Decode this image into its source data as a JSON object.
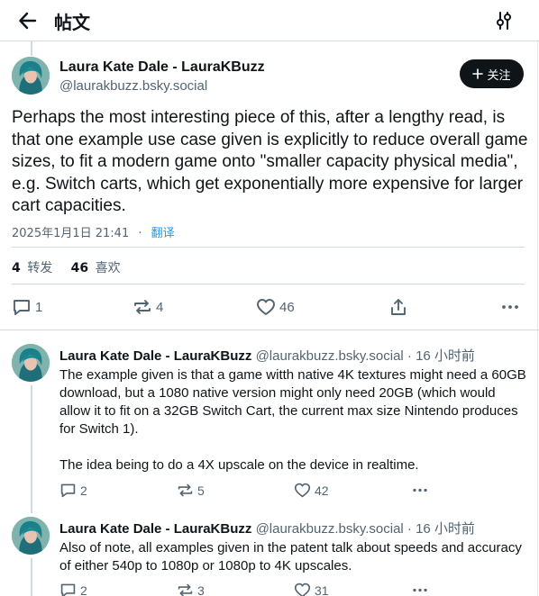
{
  "header": {
    "title": "帖文"
  },
  "post": {
    "author_name": "Laura Kate Dale - LauraKBuzz",
    "author_handle": "@laurakbuzz.bsky.social",
    "follow_label": "关注",
    "text": "Perhaps the most interesting piece of this, after a lengthy read, is that one example use case given is explicitly to reduce overall game sizes, to fit a modern game onto \"smaller capacity physical media\", e.g. Switch carts, which get exponentially more expensive for larger cart capacities.",
    "timestamp": "2025年1月1日 21:41",
    "separator": "·",
    "translate_label": "翻译",
    "reposts_count": "4",
    "reposts_label": "转发",
    "likes_count": "46",
    "likes_label": "喜欢",
    "actions": {
      "replies": "1",
      "reposts": "4",
      "likes": "46"
    }
  },
  "replies": [
    {
      "author_name": "Laura Kate Dale - LauraKBuzz",
      "author_handle": "@laurakbuzz.bsky.social",
      "time": "· 16 小时前",
      "paragraphs": [
        "The example given is that a game witth native 4K textures might need a 60GB download, but a 1080 native version might only need 20GB (which would allow it to fit on a 32GB Switch Cart, the current max size Nintendo produces for Switch 1).",
        "The idea being to do a 4X upscale on the device in realtime."
      ],
      "actions": {
        "replies": "2",
        "reposts": "5",
        "likes": "42"
      }
    },
    {
      "author_name": "Laura Kate Dale - LauraKBuzz",
      "author_handle": "@laurakbuzz.bsky.social",
      "time": "· 16 小时前",
      "paragraphs": [
        "Also of note, all examples given in the patent talk about speeds and accuracy of either 540p to 1080p or 1080p to 4K upscales."
      ],
      "actions": {
        "replies": "2",
        "reposts": "3",
        "likes": "31"
      }
    }
  ],
  "colors": {
    "accent": "#1d9bf0",
    "text": "#0f1419",
    "muted": "#536471",
    "border": "#cfd9de"
  },
  "icons": [
    "back-arrow-icon",
    "filter-icon",
    "plus-icon",
    "reply-icon",
    "repost-icon",
    "like-icon",
    "share-icon",
    "more-icon",
    "avatar"
  ]
}
